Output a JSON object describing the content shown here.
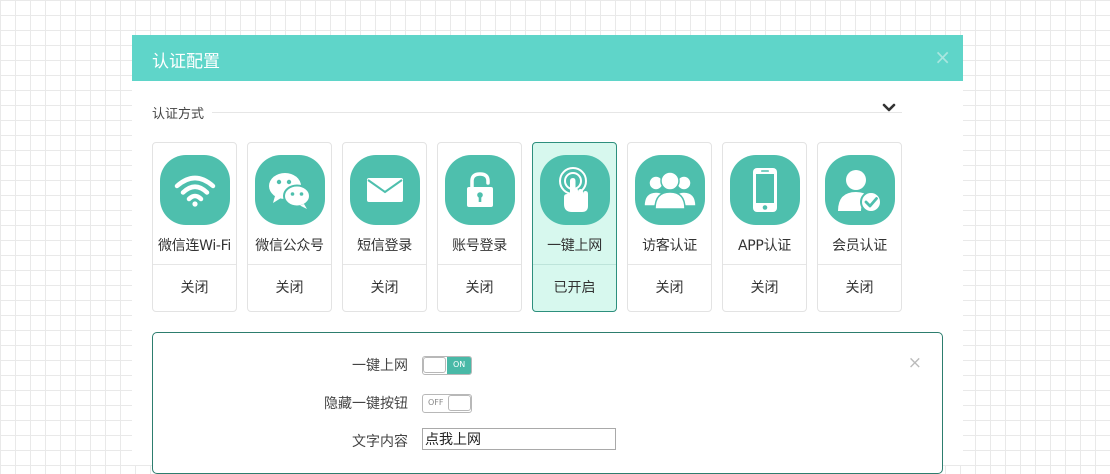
{
  "dialog": {
    "title": "认证配置",
    "close_glyph": "×"
  },
  "section": {
    "label": "认证方式",
    "collapse_icon": "chevron-down-icon"
  },
  "tiles": [
    {
      "label": "微信连Wi-Fi",
      "status": "关闭",
      "icon": "wifi-icon",
      "active": false
    },
    {
      "label": "微信公众号",
      "status": "关闭",
      "icon": "wechat-icon",
      "active": false
    },
    {
      "label": "短信登录",
      "status": "关闭",
      "icon": "envelope-icon",
      "active": false
    },
    {
      "label": "账号登录",
      "status": "关闭",
      "icon": "unlock-icon",
      "active": false
    },
    {
      "label": "一键上网",
      "status": "已开启",
      "icon": "tap-icon",
      "active": true
    },
    {
      "label": "访客认证",
      "status": "关闭",
      "icon": "visitors-icon",
      "active": false
    },
    {
      "label": "APP认证",
      "status": "关闭",
      "icon": "smartphone-icon",
      "active": false
    },
    {
      "label": "会员认证",
      "status": "关闭",
      "icon": "member-verified-icon",
      "active": false
    }
  ],
  "panel": {
    "close_glyph": "×",
    "one_click": {
      "label": "一键上网",
      "state_text": "ON",
      "enabled": true
    },
    "hide_button": {
      "label": "隐藏一键按钮",
      "state_text": "OFF",
      "enabled": false
    },
    "text_content": {
      "label": "文字内容",
      "value": "点我上网"
    }
  },
  "colors": {
    "header": "#5fd5c9",
    "icon_bg": "#4ebfad",
    "active_tile_bg": "#d7f8ee",
    "active_border": "#2d8f7d",
    "toggle_on": "#49b9a7"
  }
}
